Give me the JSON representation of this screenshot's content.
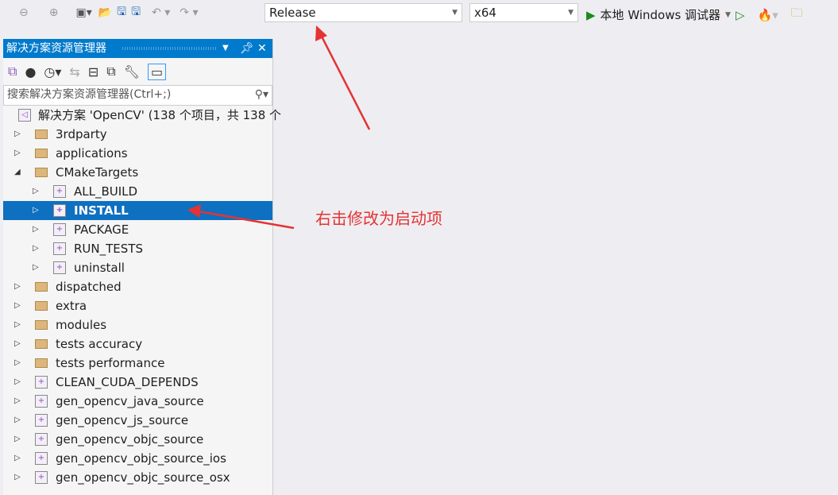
{
  "toolbar": {
    "config": "Release",
    "platform": "x64",
    "run_label": "本地 Windows 调试器"
  },
  "panel": {
    "title": "解决方案资源管理器",
    "search_placeholder": "搜索解决方案资源管理器(Ctrl+;)"
  },
  "tree": [
    {
      "label": "解决方案 'OpenCV' (138 个项目，共 138 个",
      "type": "solution",
      "level": 0
    },
    {
      "label": "3rdparty",
      "type": "folder",
      "level": 0,
      "expanded": false
    },
    {
      "label": "applications",
      "type": "folder",
      "level": 0,
      "expanded": false
    },
    {
      "label": "CMakeTargets",
      "type": "folder",
      "level": 0,
      "expanded": true
    },
    {
      "label": "ALL_BUILD",
      "type": "project",
      "level": 1
    },
    {
      "label": "INSTALL",
      "type": "project",
      "level": 1,
      "selected": true
    },
    {
      "label": "PACKAGE",
      "type": "project",
      "level": 1
    },
    {
      "label": "RUN_TESTS",
      "type": "project",
      "level": 1
    },
    {
      "label": "uninstall",
      "type": "project",
      "level": 1
    },
    {
      "label": "dispatched",
      "type": "folder",
      "level": 0
    },
    {
      "label": "extra",
      "type": "folder",
      "level": 0
    },
    {
      "label": "modules",
      "type": "folder",
      "level": 0
    },
    {
      "label": "tests accuracy",
      "type": "folder",
      "level": 0
    },
    {
      "label": "tests performance",
      "type": "folder",
      "level": 0
    },
    {
      "label": "CLEAN_CUDA_DEPENDS",
      "type": "project",
      "level": 0
    },
    {
      "label": "gen_opencv_java_source",
      "type": "project",
      "level": 0
    },
    {
      "label": "gen_opencv_js_source",
      "type": "project",
      "level": 0
    },
    {
      "label": "gen_opencv_objc_source",
      "type": "project",
      "level": 0
    },
    {
      "label": "gen_opencv_objc_source_ios",
      "type": "project",
      "level": 0
    },
    {
      "label": "gen_opencv_objc_source_osx",
      "type": "project",
      "level": 0
    }
  ],
  "annotation": {
    "text": "右击修改为启动项",
    "color": "#e53333"
  }
}
